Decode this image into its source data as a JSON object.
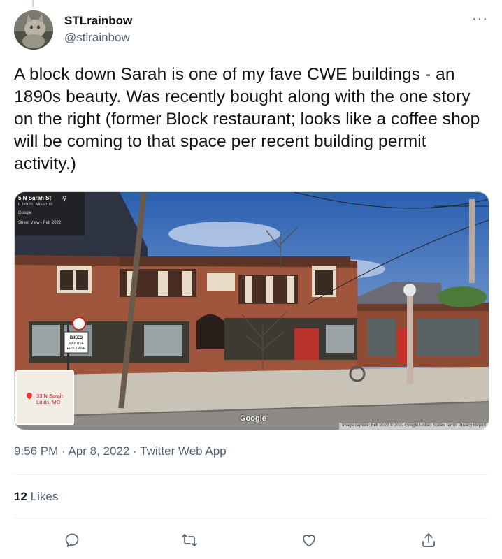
{
  "tweet": {
    "display_name": "STLrainbow",
    "handle": "@stlrainbow",
    "more_label": "···",
    "text": "A block down Sarah is one of my fave CWE buildings - an 1890s beauty. Was recently bought along with the one story on the right (former Block restaurant; looks like a coffee shop will be coming to that space per recent building permit activity.)",
    "timestamp": "9:56 PM · Apr 8, 2022 · Twitter Web App",
    "likes_count": "12",
    "likes_label": "Likes"
  },
  "media": {
    "streetview": {
      "address": "5 N Sarah St",
      "city": "t. Louis, Missouri",
      "brand": "Google",
      "date_label": "Street View - Feb 2022"
    },
    "minimap": {
      "street": "ate Ave",
      "pin_label_line1": "33 N Sarah",
      "pin_label_line2": "Louis, MO"
    },
    "sign_text": [
      "BIKES",
      "MAY USE",
      "FULL LANE"
    ],
    "watermark": "Google",
    "footer": "Image capture: Feb 2022   © 2022 Google   United States   Terms   Privacy   Report"
  },
  "icons": {
    "avatar": "avatar-image",
    "reply": "reply-icon",
    "retweet": "retweet-icon",
    "like": "heart-icon",
    "share": "share-icon"
  },
  "colors": {
    "text_primary": "#0f1419",
    "text_secondary": "#536471",
    "divider": "#eff3f4",
    "icon": "#536471"
  }
}
